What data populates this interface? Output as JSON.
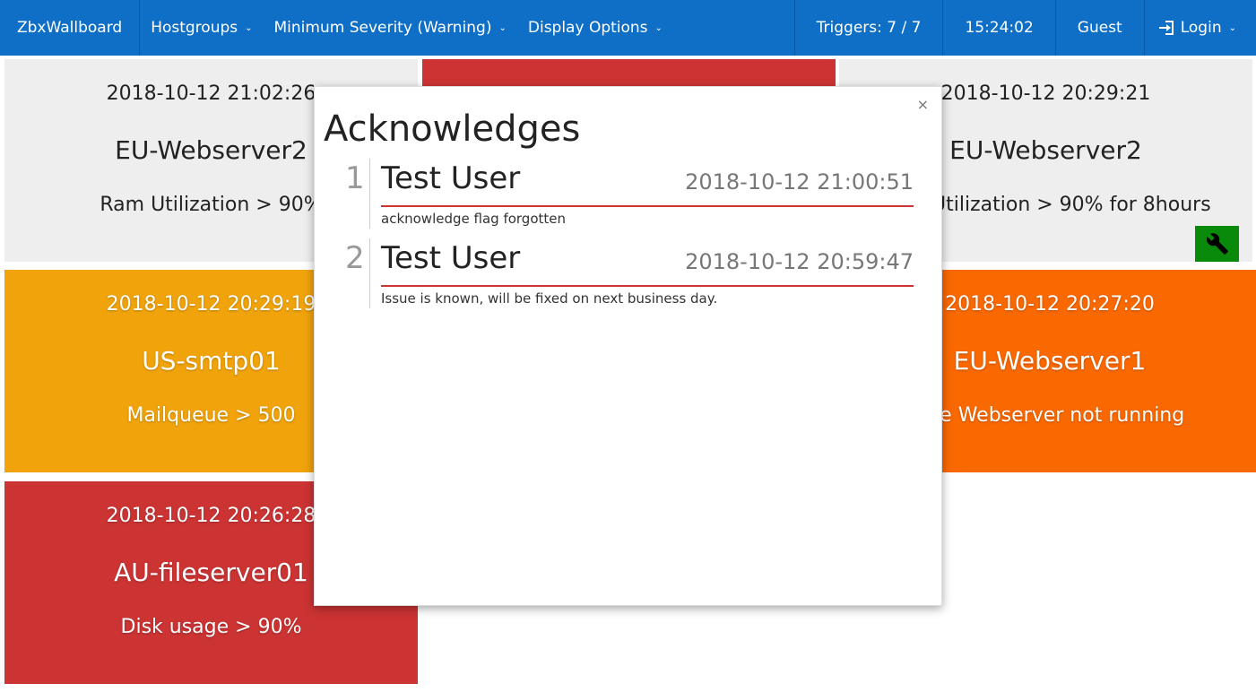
{
  "navbar": {
    "brand": "ZbxWallboard",
    "menus": [
      {
        "label": "Hostgroups"
      },
      {
        "label": "Minimum Severity (Warning)"
      },
      {
        "label": "Display Options"
      }
    ],
    "triggers": "Triggers: 7 / 7",
    "clock": "15:24:02",
    "user": "Guest",
    "login": "Login"
  },
  "tiles": [
    {
      "time": "2018-10-12 21:02:26",
      "host": "EU-Webserver2",
      "desc": "Ram Utilization > 90%",
      "color": "#eeeeee"
    },
    {
      "time": "2018-10-12 20:29:21",
      "host": "EU-Webserver2",
      "desc": "Ram Utilization > 90% for 8hours",
      "color": "#eeeeee",
      "icon": "wrench-icon",
      "icon_color": "#0a8a0a"
    },
    {
      "time": "2018-10-12 20:29:19",
      "host": "US-smtp01",
      "desc": "Mailqueue > 500",
      "color": "#f0a30a"
    },
    {
      "time": "2018-10-12 20:27:20",
      "host": "EU-Webserver1",
      "desc": "The Webserver not running",
      "color": "#fa6800"
    },
    {
      "time": "2018-10-12 20:26:28",
      "host": "AU-fileserver01",
      "desc": "Disk usage > 90%",
      "color": "#cc3333"
    },
    {
      "color": "#cc3333"
    }
  ],
  "modal": {
    "title": "Acknowledges",
    "close": "×",
    "items": [
      {
        "num": "1",
        "user": "Test User",
        "date": "2018-10-12 21:00:51",
        "message": "acknowledge flag forgotten"
      },
      {
        "num": "2",
        "user": "Test User",
        "date": "2018-10-12 20:59:47",
        "message": "Issue is known, will be fixed on next business day."
      }
    ]
  }
}
